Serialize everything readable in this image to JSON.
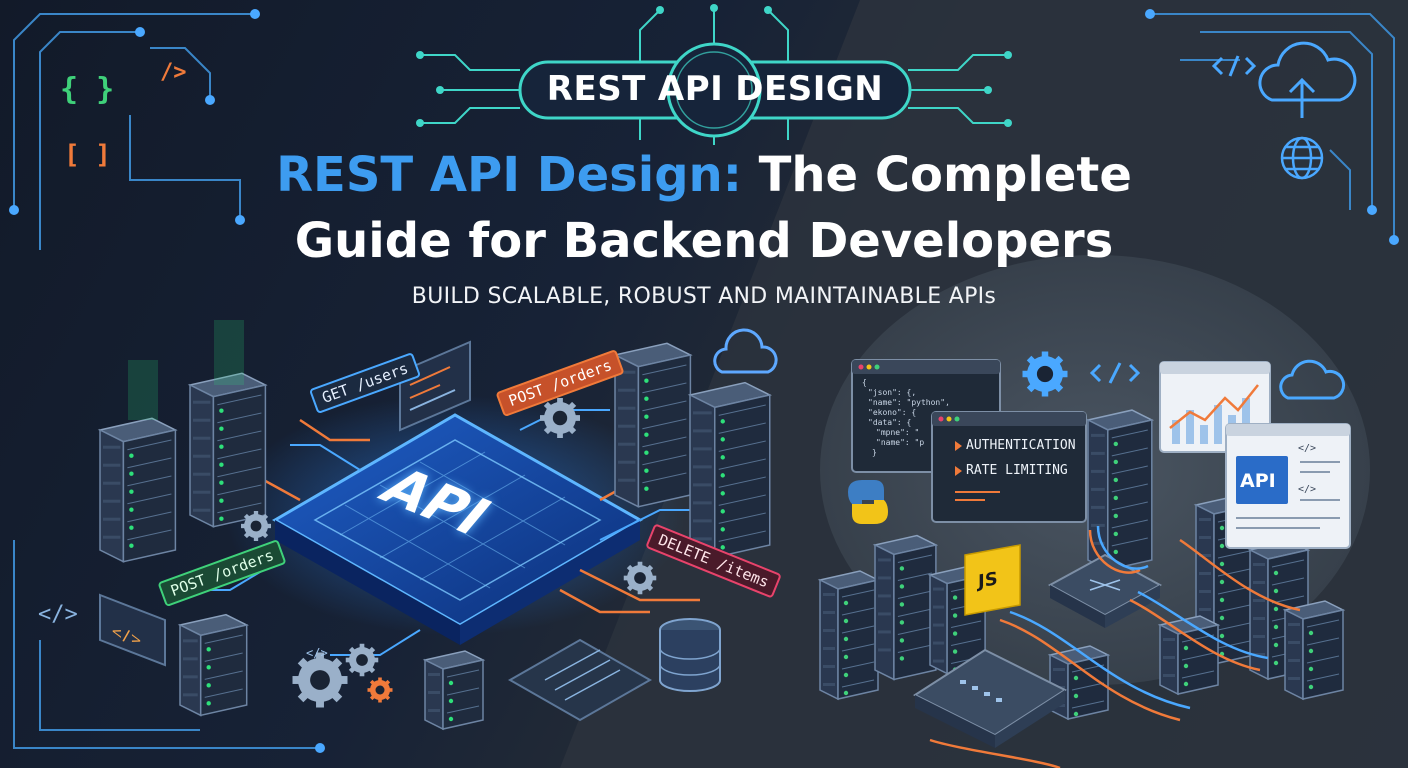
{
  "badge": {
    "word1": "REST",
    "word2": "API",
    "word3": "DESIGN"
  },
  "title": {
    "highlight": "REST API Design:",
    "line1_rest": " The Complete",
    "line2": "Guide for Backend Developers"
  },
  "subtitle": "BUILD SCALABLE, ROBUST AND MAINTAINABLE APIs",
  "left_scene": {
    "chip_label": "API",
    "tags": {
      "get_users": "GET /users",
      "post_orders_top": "POST /orders",
      "post_orders_left": "POST /orders",
      "delete_items": "DELETE /items"
    }
  },
  "right_scene": {
    "features": [
      "AUTHENTICATION",
      "RATE LIMITING"
    ],
    "json_lines": [
      "{",
      "\"json\": {,",
      "\"name\": \"python\",",
      "\"ekono\": {",
      "\"data\": {",
      "\"mpne\": \"",
      "\"name\": \"p",
      "}"
    ],
    "doc_badge": "API",
    "js_badge": "JS"
  },
  "icons": {
    "braces": "{ }",
    "brackets": "[ ]",
    "tag_close": "/>",
    "code_tag": "</>"
  },
  "colors": {
    "accent_blue": "#3d9cf0",
    "accent_orange": "#f07a3a",
    "accent_green": "#3fd17a",
    "accent_red": "#e8436b",
    "js_yellow": "#f2c418"
  }
}
